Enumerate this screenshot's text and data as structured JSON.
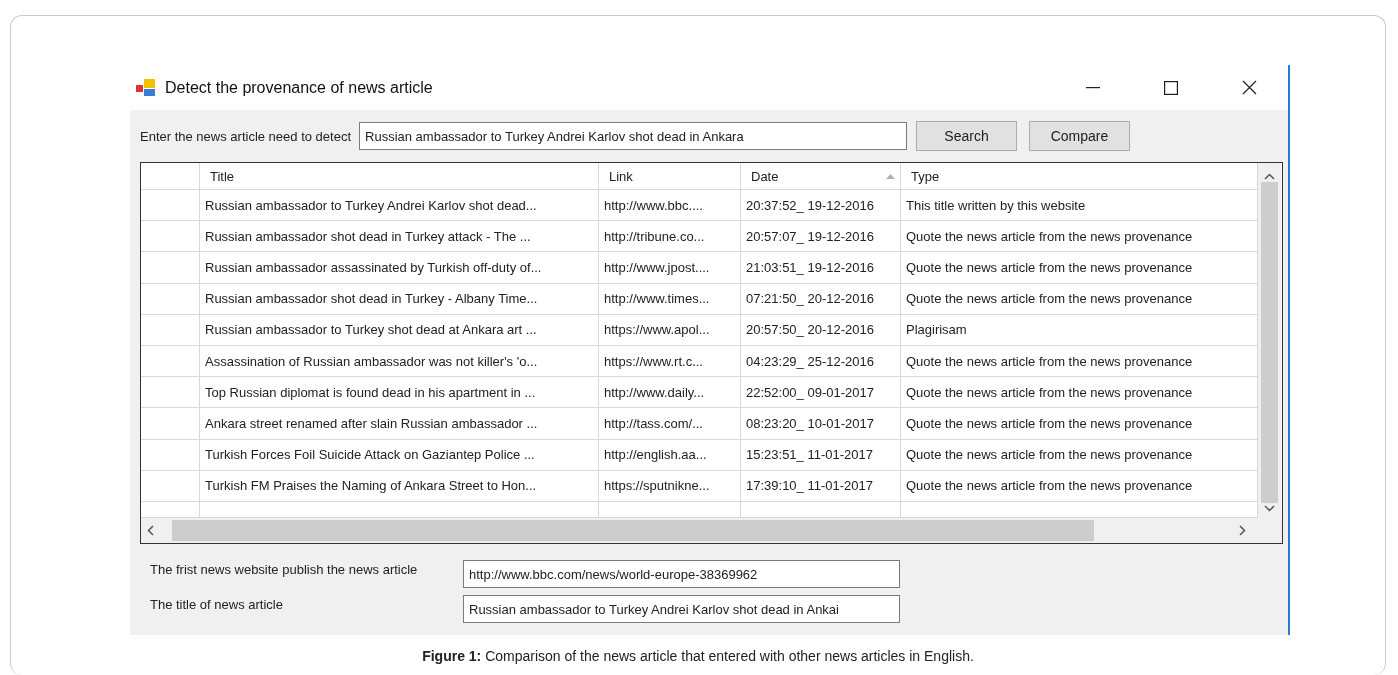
{
  "window": {
    "title": "Detect the provenance of news article"
  },
  "search": {
    "label": "Enter the news article need to detect",
    "value": "Russian ambassador to Turkey Andrei Karlov shot dead in Ankara"
  },
  "buttons": [
    "Search",
    "Compare"
  ],
  "table": {
    "columns": [
      {
        "label": "Title",
        "sorted": false
      },
      {
        "label": "Link",
        "sorted": false
      },
      {
        "label": "Date",
        "sorted": true
      },
      {
        "label": "Type",
        "sorted": false
      }
    ],
    "rows": [
      {
        "title": "Russian ambassador to Turkey Andrei Karlov shot dead...",
        "link": "http://www.bbc....",
        "date": "20:37:52_ 19-12-2016",
        "type": "This title written by this website"
      },
      {
        "title": "Russian ambassador shot dead in Turkey attack - The ...",
        "link": "http://tribune.co...",
        "date": "20:57:07_ 19-12-2016",
        "type": "Quote the news article from the news provenance"
      },
      {
        "title": "Russian ambassador assassinated by Turkish off-duty of...",
        "link": "http://www.jpost....",
        "date": "21:03:51_ 19-12-2016",
        "type": "Quote the news article from the news provenance"
      },
      {
        "title": "Russian ambassador shot dead in Turkey - Albany Time...",
        "link": "http://www.times...",
        "date": "07:21:50_ 20-12-2016",
        "type": "Quote the news article from the news provenance"
      },
      {
        "title": "Russian ambassador to Turkey shot dead at Ankara art ...",
        "link": "https://www.apol...",
        "date": "20:57:50_ 20-12-2016",
        "type": "Plagirisam"
      },
      {
        "title": "Assassination of Russian ambassador was not killer's 'o...",
        "link": "https://www.rt.c...",
        "date": "04:23:29_ 25-12-2016",
        "type": "Quote the news article from the news provenance"
      },
      {
        "title": "Top Russian diplomat is found dead in his apartment in ...",
        "link": "http://www.daily...",
        "date": "22:52:00_ 09-01-2017",
        "type": "Quote the news article from the news provenance"
      },
      {
        "title": "Ankara street renamed after slain Russian ambassador ...",
        "link": "http://tass.com/...",
        "date": "08:23:20_ 10-01-2017",
        "type": "Quote the news article from the news provenance"
      },
      {
        "title": "Turkish Forces Foil Suicide Attack on Gaziantep Police ...",
        "link": "http://english.aa...",
        "date": "15:23:51_ 11-01-2017",
        "type": "Quote the news article from the news provenance"
      },
      {
        "title": "Turkish FM Praises the Naming of Ankara Street to Hon...",
        "link": "https://sputnikne...",
        "date": "17:39:10_ 11-01-2017",
        "type": "Quote the news article from the news provenance"
      }
    ]
  },
  "results": [
    {
      "label": "The frist news website publish the news article",
      "value": "http://www.bbc.com/news/world-europe-38369962"
    },
    {
      "label": "The title of news article",
      "value": "Russian ambassador to Turkey Andrei Karlov shot dead in Ankai"
    }
  ],
  "caption": "**Figure 1:** Comparison of the news article that entered with other news articles in English."
}
